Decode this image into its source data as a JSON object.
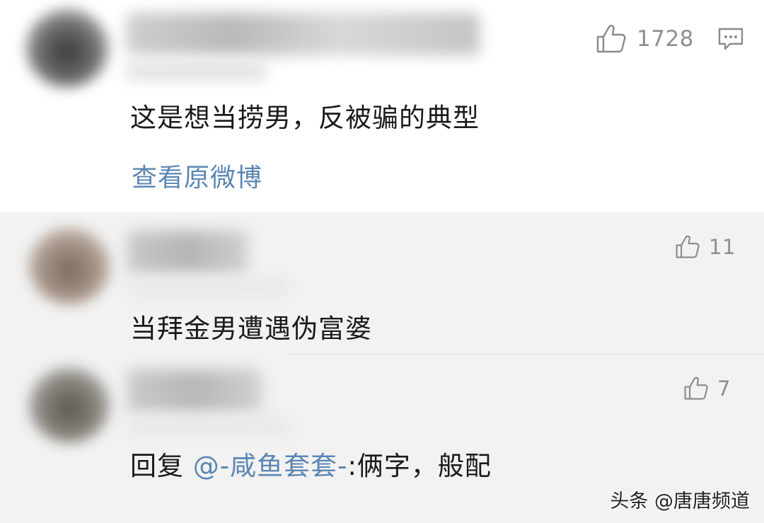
{
  "main_comment": {
    "like_count": "1728",
    "text": "这是想当捞男，反被骗的典型",
    "view_original_label": "查看原微博"
  },
  "replies": [
    {
      "like_count": "11",
      "text": "当拜金男遭遇伪富婆"
    },
    {
      "like_count": "7",
      "reply_prefix": "回复 ",
      "mention": "@-咸鱼套套-",
      "text": ":俩字，般配"
    }
  ],
  "watermark": "头条 @唐唐频道",
  "icons": {
    "like": "thumbs-up-icon",
    "comment": "comment-bubble-icon"
  },
  "colors": {
    "link": "#5b86b3",
    "reply_bg": "#f2f2f2",
    "count": "#8f8f8f"
  }
}
